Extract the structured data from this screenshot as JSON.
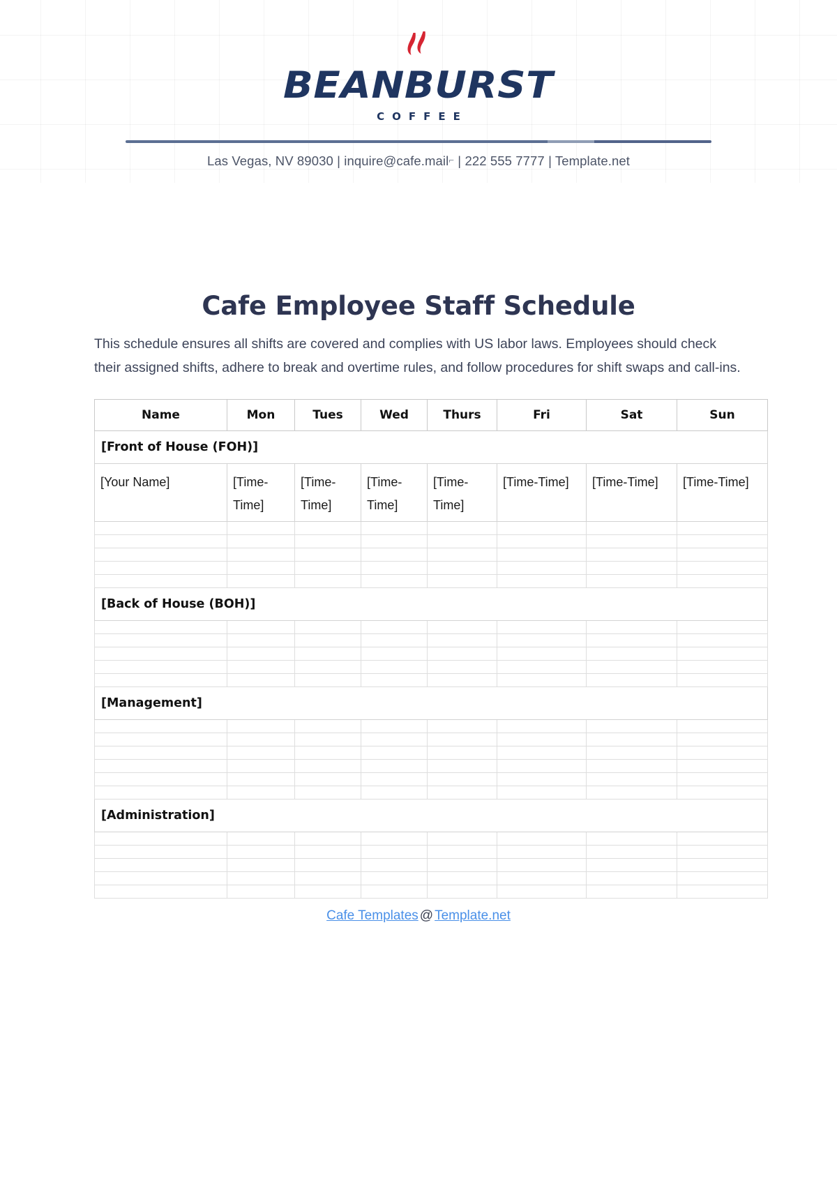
{
  "header": {
    "logo": {
      "icon": "flame-icon",
      "brand": "BEANBURST",
      "tagline": "COFFEE",
      "brand_color": "#1f3560",
      "flame_color": "#d62532"
    },
    "contact": {
      "address": "Las Vegas, NV 89030",
      "sep1": "|",
      "email": "inquire@cafe.mail",
      "email_glyph": "⌐",
      "sep2": "|",
      "phone": "222 555 7777",
      "sep3": "|",
      "website": "Template.net",
      "full_line": "Las Vegas, NV 89030 | inquire@cafe.mail⌐ | 222 555 7777 | Template.net"
    }
  },
  "document": {
    "title": "Cafe Employee Staff Schedule",
    "intro": "This schedule ensures all shifts are covered and complies with US labor laws. Employees should check their assigned shifts, adhere to break and overtime rules, and follow procedures for shift swaps and call-ins."
  },
  "table": {
    "columns": [
      "Name",
      "Mon",
      "Tues",
      "Wed",
      "Thurs",
      "Fri",
      "Sat",
      "Sun"
    ],
    "sections": [
      {
        "label": "[Front of House (FOH)]",
        "rows": [
          [
            "[Your Name]",
            "[Time-Time]",
            "[Time-Time]",
            "[Time-Time]",
            "[Time-Time]",
            "[Time-Time]",
            "[Time-Time]",
            "[Time-Time]"
          ]
        ],
        "blank_rows": 5
      },
      {
        "label": "[Back of House (BOH)]",
        "rows": [],
        "blank_rows": 5
      },
      {
        "label": "[Management]",
        "rows": [],
        "blank_rows": 6
      },
      {
        "label": "[Administration]",
        "rows": [],
        "blank_rows": 5
      }
    ]
  },
  "footer": {
    "link_left": "Cafe Templates",
    "at": "@",
    "link_right": "Template.net",
    "link_color": "#4a90e8"
  }
}
